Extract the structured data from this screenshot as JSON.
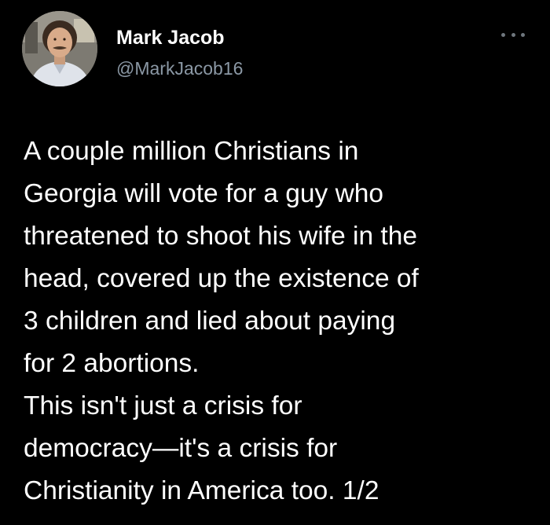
{
  "author": {
    "display_name": "Mark Jacob",
    "handle": "@MarkJacob16",
    "avatar_icon": "profile-photo"
  },
  "menu": {
    "icon": "more-options-icon"
  },
  "tweet": {
    "lines": [
      "A couple million Christians in",
      "Georgia will vote for a guy who",
      "threatened to shoot his wife in the",
      "head, covered up the existence of",
      "3 children and lied about paying",
      "for 2 abortions.",
      "This isn't just a crisis for",
      "democracy—it's a crisis for",
      "Christianity in America too. 1/2"
    ]
  },
  "colors": {
    "background": "#000000",
    "text": "#ffffff",
    "secondary": "#8b98a5"
  }
}
